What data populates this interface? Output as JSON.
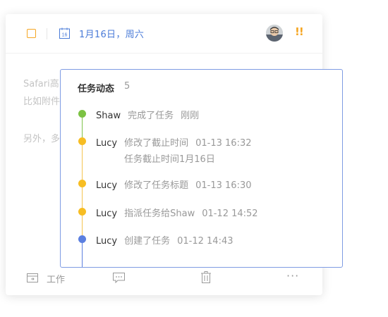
{
  "task": {
    "due_date": "1月16日，周六",
    "description_lines": [
      "Safari高",
      "比如附件",
      "另外，多"
    ],
    "project": "工作",
    "more": "···",
    "priority": "!!"
  },
  "activity": {
    "title": "任务动态",
    "count": "5",
    "entries": [
      {
        "user": "Shaw",
        "action": "完成了任务",
        "time": "刚刚",
        "detail": "",
        "color": "#7cc243"
      },
      {
        "user": "Lucy",
        "action": "修改了截止时间",
        "time": "01-13  16:32",
        "detail": "任务截止时间1月16日",
        "color": "#f7bd22"
      },
      {
        "user": "Lucy",
        "action": "修改了任务标题",
        "time": "01-13  16:30",
        "detail": "",
        "color": "#f7bd22"
      },
      {
        "user": "Lucy",
        "action": "指派任务给Shaw",
        "time": "01-12  14:52",
        "detail": "",
        "color": "#f7bd22"
      },
      {
        "user": "Lucy",
        "action": "创建了任务",
        "time": "01-12  14:43",
        "detail": "",
        "color": "#5b7fe0"
      }
    ]
  },
  "colors": {
    "accent": "#4a7bd8",
    "warning": "#f5a623",
    "popover_border": "#7e9be3"
  },
  "icons": [
    "checkbox-icon",
    "calendar-icon",
    "avatar",
    "priority-icon",
    "project-icon",
    "comment-icon",
    "trash-icon",
    "more-icon"
  ]
}
